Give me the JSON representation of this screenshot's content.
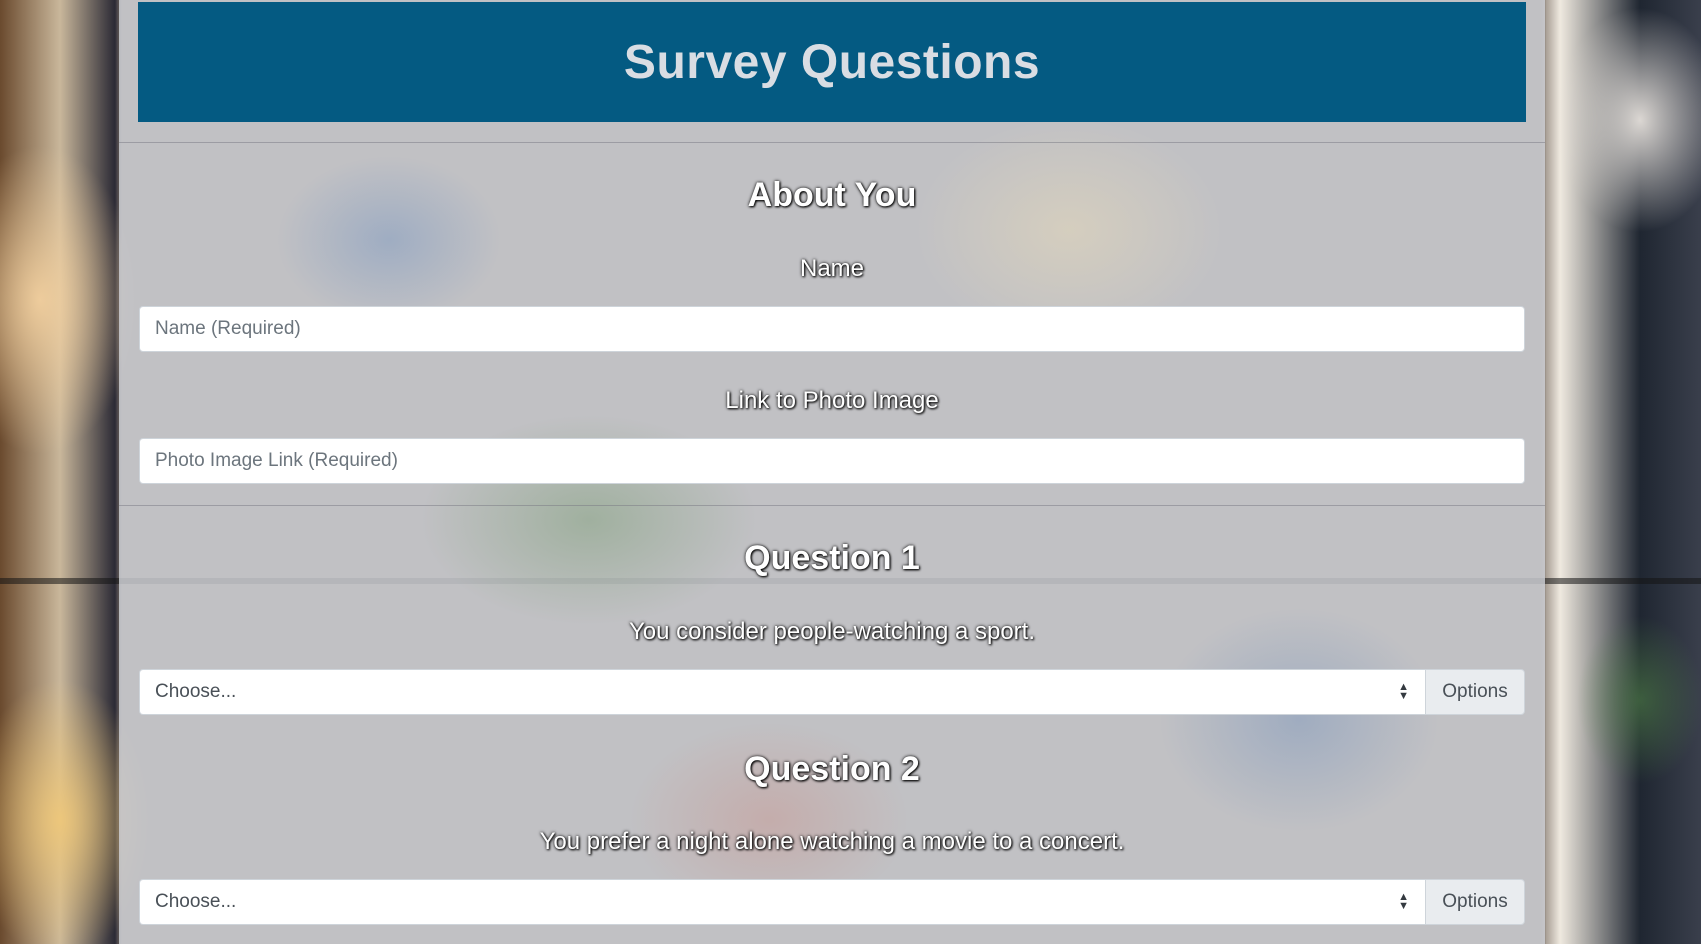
{
  "page": {
    "title": "Survey Questions"
  },
  "about": {
    "heading": "About You",
    "name_label": "Name",
    "name_placeholder": "Name (Required)",
    "photo_label": "Link to Photo Image",
    "photo_placeholder": "Photo Image Link (Required)"
  },
  "questions": [
    {
      "heading": "Question 1",
      "text": "You consider people-watching a sport.",
      "select_value": "Choose...",
      "addon_label": "Options"
    },
    {
      "heading": "Question 2",
      "text": "You prefer a night alone watching a movie to a concert.",
      "select_value": "Choose...",
      "addon_label": "Options"
    }
  ],
  "colors": {
    "header_bg": "#045a82",
    "header_text": "#d9dde3",
    "label_text": "#ffffff"
  }
}
